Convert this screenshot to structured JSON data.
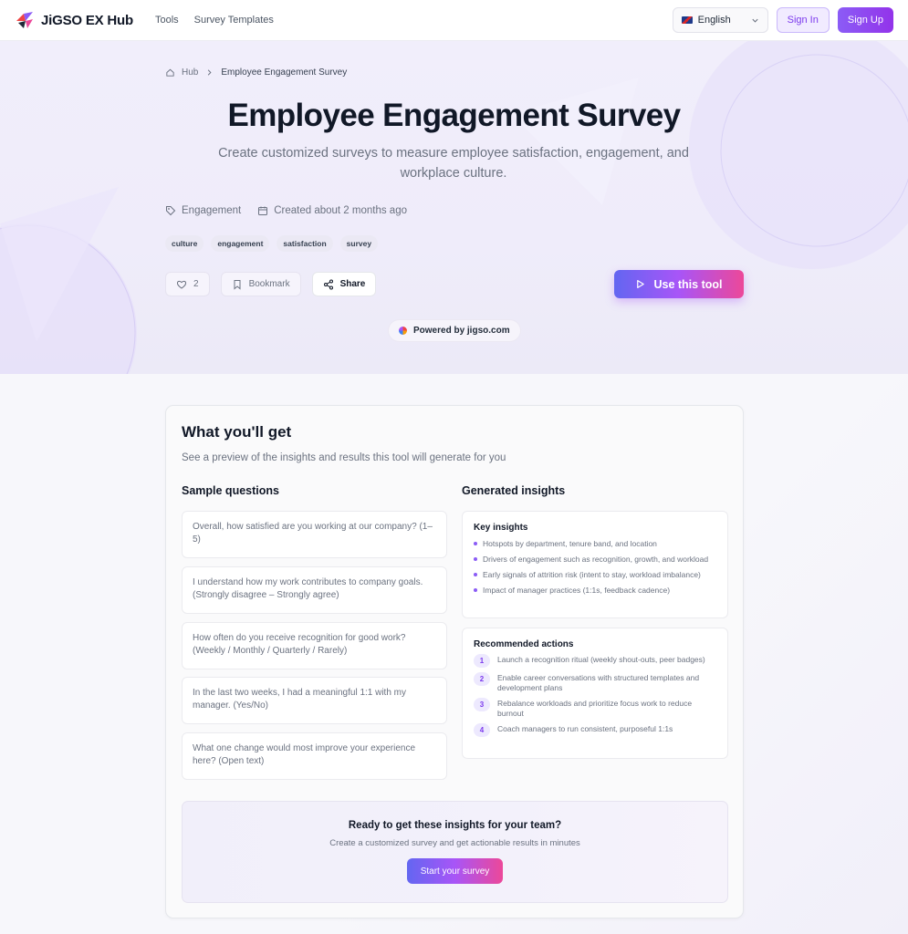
{
  "header": {
    "brand": "JiGSO EX Hub",
    "nav": [
      "Tools",
      "Survey Templates"
    ],
    "language": "English",
    "sign_in": "Sign In",
    "sign_up": "Sign Up"
  },
  "hero": {
    "breadcrumb": [
      "Hub",
      "Employee Engagement Survey"
    ],
    "title": "Employee Engagement Survey",
    "subtitle": "Create customized surveys to measure employee satisfaction, engagement, and workplace culture.",
    "category": "Engagement",
    "created": "Created about 2 months ago",
    "tags": [
      "culture",
      "engagement",
      "satisfaction",
      "survey"
    ],
    "likes": "2",
    "bookmark": "Bookmark",
    "share": "Share",
    "use_tool": "Use this tool",
    "powered": "Powered by jigso.com"
  },
  "preview": {
    "title": "What you'll get",
    "intro": "See a preview of the insights and results this tool will generate for you",
    "questions_title": "Sample questions",
    "questions": [
      "Overall, how satisfied are you working at our company? (1–5)",
      "I understand how my work contributes to company goals. (Strongly disagree – Strongly agree)",
      "How often do you receive recognition for good work? (Weekly / Monthly / Quarterly / Rarely)",
      "In the last two weeks, I had a meaningful 1:1 with my manager. (Yes/No)",
      "What one change would most improve your experience here? (Open text)"
    ],
    "insights_title": "Generated insights",
    "key_insights_title": "Key insights",
    "key_insights": [
      "Hotspots by department, tenure band, and location",
      "Drivers of engagement such as recognition, growth, and workload",
      "Early signals of attrition risk (intent to stay, workload imbalance)",
      "Impact of manager practices (1:1s, feedback cadence)"
    ],
    "actions_title": "Recommended actions",
    "actions": [
      {
        "num": "1",
        "text": "Launch a recognition ritual (weekly shout-outs, peer badges)"
      },
      {
        "num": "2",
        "text": "Enable career conversations with structured templates and development plans"
      },
      {
        "num": "3",
        "text": "Rebalance workloads and prioritize focus work to reduce burnout"
      },
      {
        "num": "4",
        "text": "Coach managers to run consistent, purposeful 1:1s"
      }
    ]
  },
  "cta": {
    "title": "Ready to get these insights for your team?",
    "text": "Create a customized survey and get actionable results in minutes",
    "button": "Start your survey"
  }
}
